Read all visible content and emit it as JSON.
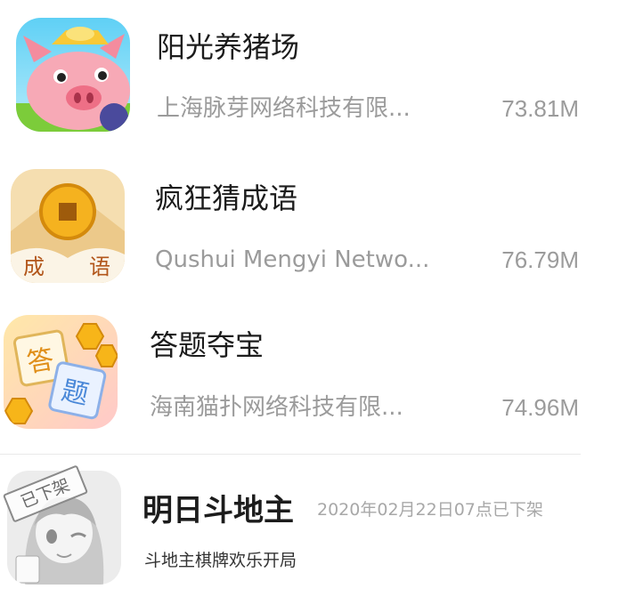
{
  "apps": [
    {
      "name": "阳光养猪场",
      "developer": "上海脉芽网络科技有限...",
      "size": "73.81M",
      "icon": "pig-game-icon"
    },
    {
      "name": "疯狂猜成语",
      "developer": "Qushui Mengyi Netwo...",
      "size": "76.79M",
      "icon": "idiom-coin-icon",
      "icon_text": [
        "成",
        "语"
      ]
    },
    {
      "name": "答题夺宝",
      "developer": "海南猫扑网络科技有限...",
      "size": "74.96M",
      "icon": "quiz-cards-icon",
      "icon_text": [
        "答",
        "题"
      ]
    }
  ],
  "offline_app": {
    "name": "明日斗地主",
    "status": "2020年02月22日07点已下架",
    "description": "斗地主棋牌欢乐开局",
    "stamp": "已下架",
    "icon": "anime-girl-icon"
  }
}
